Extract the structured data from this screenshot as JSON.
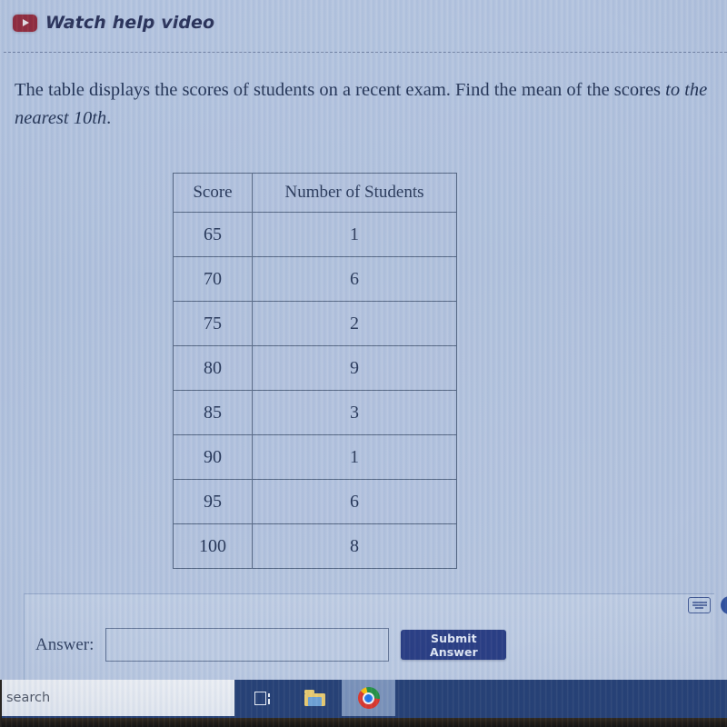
{
  "help_link": {
    "label": "Watch help video",
    "icon": "youtube-play-icon"
  },
  "question": {
    "text_part1": "The table displays the scores of students on a recent exam. Find the mean of the scores ",
    "text_emphasis": "to the nearest 10th",
    "text_part2": "."
  },
  "table": {
    "headers": [
      "Score",
      "Number of Students"
    ],
    "rows": [
      {
        "score": "65",
        "count": "1"
      },
      {
        "score": "70",
        "count": "6"
      },
      {
        "score": "75",
        "count": "2"
      },
      {
        "score": "80",
        "count": "9"
      },
      {
        "score": "85",
        "count": "3"
      },
      {
        "score": "90",
        "count": "1"
      },
      {
        "score": "95",
        "count": "6"
      },
      {
        "score": "100",
        "count": "8"
      }
    ]
  },
  "answer_area": {
    "label": "Answer:",
    "input_value": "",
    "input_placeholder": "",
    "submit_label": "Submit Answer",
    "keyboard_icon": "keyboard-icon"
  },
  "taskbar": {
    "search_placeholder": "search",
    "items": [
      {
        "name": "task-view",
        "icon": "task-view-icon"
      },
      {
        "name": "file-explorer",
        "icon": "folder-icon"
      },
      {
        "name": "google-chrome",
        "icon": "chrome-icon"
      }
    ]
  },
  "colors": {
    "page_background": "#aebfdc",
    "text": "#1b2b4d",
    "submit_button": "#23377f",
    "taskbar": "#1f3a70",
    "youtube_red": "#8e2436",
    "table_border": "#4b5d7a"
  },
  "chart_data": {
    "type": "table",
    "title": "Exam scores frequency distribution",
    "columns": [
      "Score",
      "Number of Students"
    ],
    "categories": [
      65,
      70,
      75,
      80,
      85,
      90,
      95,
      100
    ],
    "values": [
      1,
      6,
      2,
      9,
      3,
      1,
      6,
      8
    ],
    "xlabel": "Score",
    "ylabel": "Number of Students"
  }
}
